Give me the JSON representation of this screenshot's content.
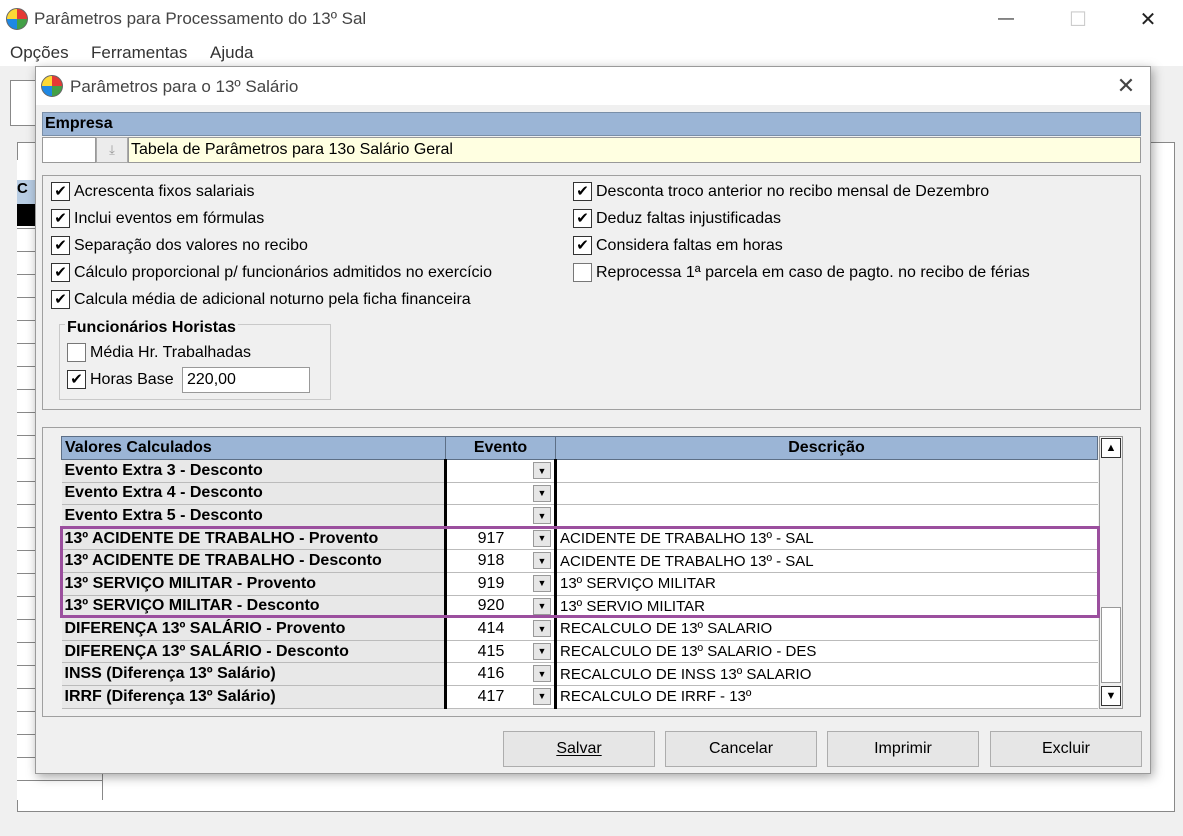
{
  "window": {
    "title": "Parâmetros para Processamento do 13º Sal",
    "minimize": "—",
    "maximize": "☐",
    "close": "✕"
  },
  "menu": [
    "Opções",
    "Ferramentas",
    "Ajuda"
  ],
  "background": {
    "grid_header": "C"
  },
  "dialog": {
    "title": "Parâmetros para o 13º Salário",
    "close": "✕",
    "empresa_label": "Empresa",
    "empresa_code": "",
    "empresa_name": "Tabela de Parâmetros para 13o Salário Geral",
    "options_left": [
      {
        "label": "Acrescenta fixos salariais",
        "checked": true
      },
      {
        "label": "Inclui eventos em fórmulas",
        "checked": true
      },
      {
        "label": "Separação dos valores no recibo",
        "checked": true
      },
      {
        "label": "Cálculo proporcional p/ funcionários admitidos no exercício",
        "checked": true
      },
      {
        "label": "Calcula média de adicional noturno pela ficha financeira",
        "checked": true
      }
    ],
    "options_right": [
      {
        "label": "Desconta troco anterior no recibo mensal de Dezembro",
        "checked": true
      },
      {
        "label": "Deduz faltas injustificadas",
        "checked": true
      },
      {
        "label": "Considera faltas em horas",
        "checked": true
      },
      {
        "label": "Reprocessa 1ª parcela em caso de pagto. no recibo de férias",
        "checked": false
      }
    ],
    "horistas": {
      "title": "Funcionários Horistas",
      "media_label": "Média Hr. Trabalhadas",
      "media_checked": false,
      "horas_base_label": "Horas Base",
      "horas_base_checked": true,
      "horas_base_value": "220,00"
    },
    "grid": {
      "headers": [
        "Valores Calculados",
        "Evento",
        "Descrição"
      ],
      "rows": [
        {
          "name": "Evento Extra 3 - Desconto",
          "evento": "",
          "descricao": ""
        },
        {
          "name": "Evento Extra 4 - Desconto",
          "evento": "",
          "descricao": ""
        },
        {
          "name": "Evento Extra 5 - Desconto",
          "evento": "",
          "descricao": ""
        },
        {
          "name": "13º ACIDENTE DE TRABALHO - Provento",
          "evento": "917",
          "descricao": "ACIDENTE DE TRABALHO 13º - SAL"
        },
        {
          "name": "13º ACIDENTE DE TRABALHO - Desconto",
          "evento": "918",
          "descricao": "ACIDENTE DE TRABALHO 13º - SAL"
        },
        {
          "name": "13º SERVIÇO MILITAR - Provento",
          "evento": "919",
          "descricao": "13º SERVIÇO MILITAR"
        },
        {
          "name": "13º SERVIÇO MILITAR - Desconto",
          "evento": "920",
          "descricao": "13º SERVIO MILITAR"
        },
        {
          "name": "DIFERENÇA 13º SALÁRIO - Provento",
          "evento": "414",
          "descricao": "RECALCULO DE 13º SALARIO"
        },
        {
          "name": "DIFERENÇA 13º SALÁRIO - Desconto",
          "evento": "415",
          "descricao": "RECALCULO DE 13º SALARIO - DES"
        },
        {
          "name": "INSS (Diferença 13º Salário)",
          "evento": "416",
          "descricao": "RECALCULO DE INSS 13º SALARIO"
        },
        {
          "name": "IRRF (Diferença 13º Salário)",
          "evento": "417",
          "descricao": "RECALCULO DE IRRF - 13º"
        }
      ]
    },
    "buttons": {
      "save": "Salvar",
      "cancel": "Cancelar",
      "print": "Imprimir",
      "delete": "Excluir"
    },
    "highlight_color": "#9b4f9e"
  }
}
